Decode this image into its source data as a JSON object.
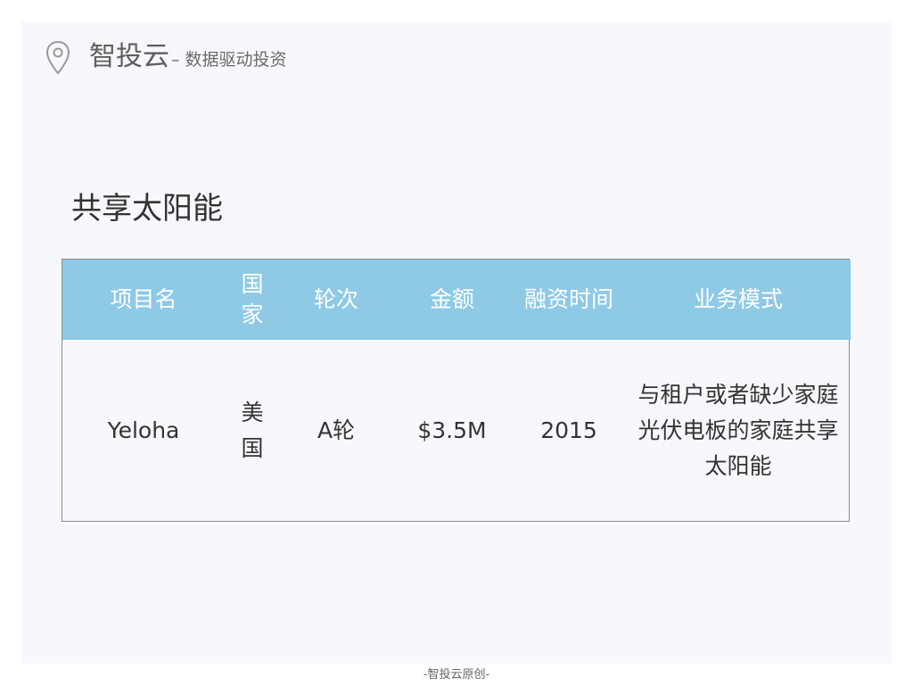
{
  "header": {
    "brand": "智投云",
    "subtitle": "– 数据驱动投资",
    "logo_icon": "location-pin-icon"
  },
  "page": {
    "title": "共享太阳能"
  },
  "table": {
    "columns": [
      "项目名",
      "国家",
      "轮次",
      "金额",
      "融资时间",
      "业务模式"
    ],
    "rows": [
      {
        "name": "Yeloha",
        "country": "美国",
        "round": "A轮",
        "amount": "$3.5M",
        "year": "2015",
        "model": "与租户或者缺少家庭光伏电板的家庭共享太阳能"
      }
    ]
  },
  "footer": {
    "text": "-智投云原创-"
  },
  "colors": {
    "header_row": "#8ec9e6",
    "slide_bg": "#f7f8fb"
  }
}
